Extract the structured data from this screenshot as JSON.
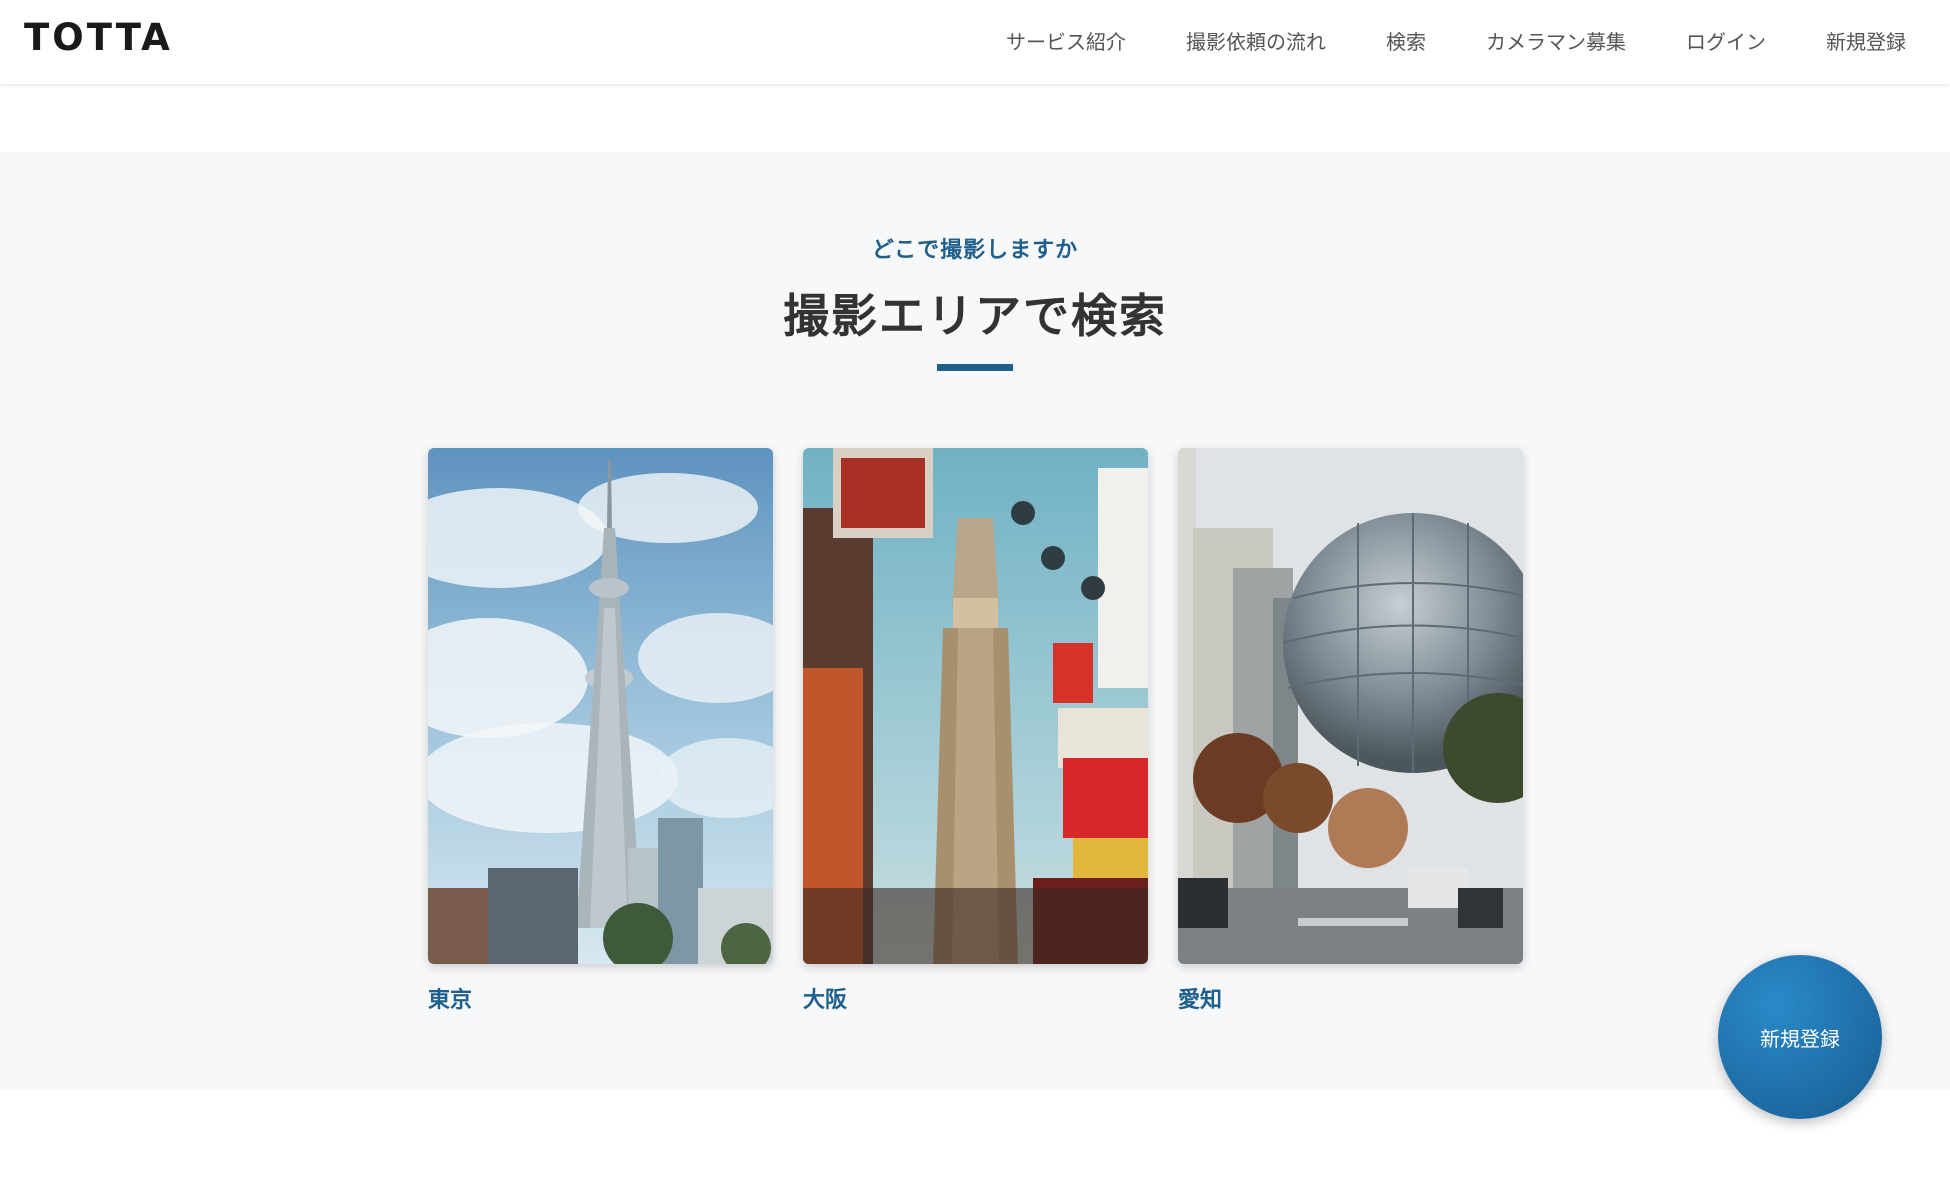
{
  "header": {
    "logo": "TOTTA",
    "nav": [
      "サービス紹介",
      "撮影依頼の流れ",
      "検索",
      "カメラマン募集",
      "ログイン",
      "新規登録"
    ]
  },
  "area_section": {
    "eyebrow": "どこで撮影しますか",
    "title": "撮影エリアで検索",
    "cards": [
      {
        "label": "東京"
      },
      {
        "label": "大阪"
      },
      {
        "label": "愛知"
      }
    ]
  },
  "floating_button": {
    "label": "新規登録"
  },
  "colors": {
    "accent": "#1f5f8b",
    "section_bg": "#f6f8fa",
    "fab": "#1d6aa3"
  }
}
